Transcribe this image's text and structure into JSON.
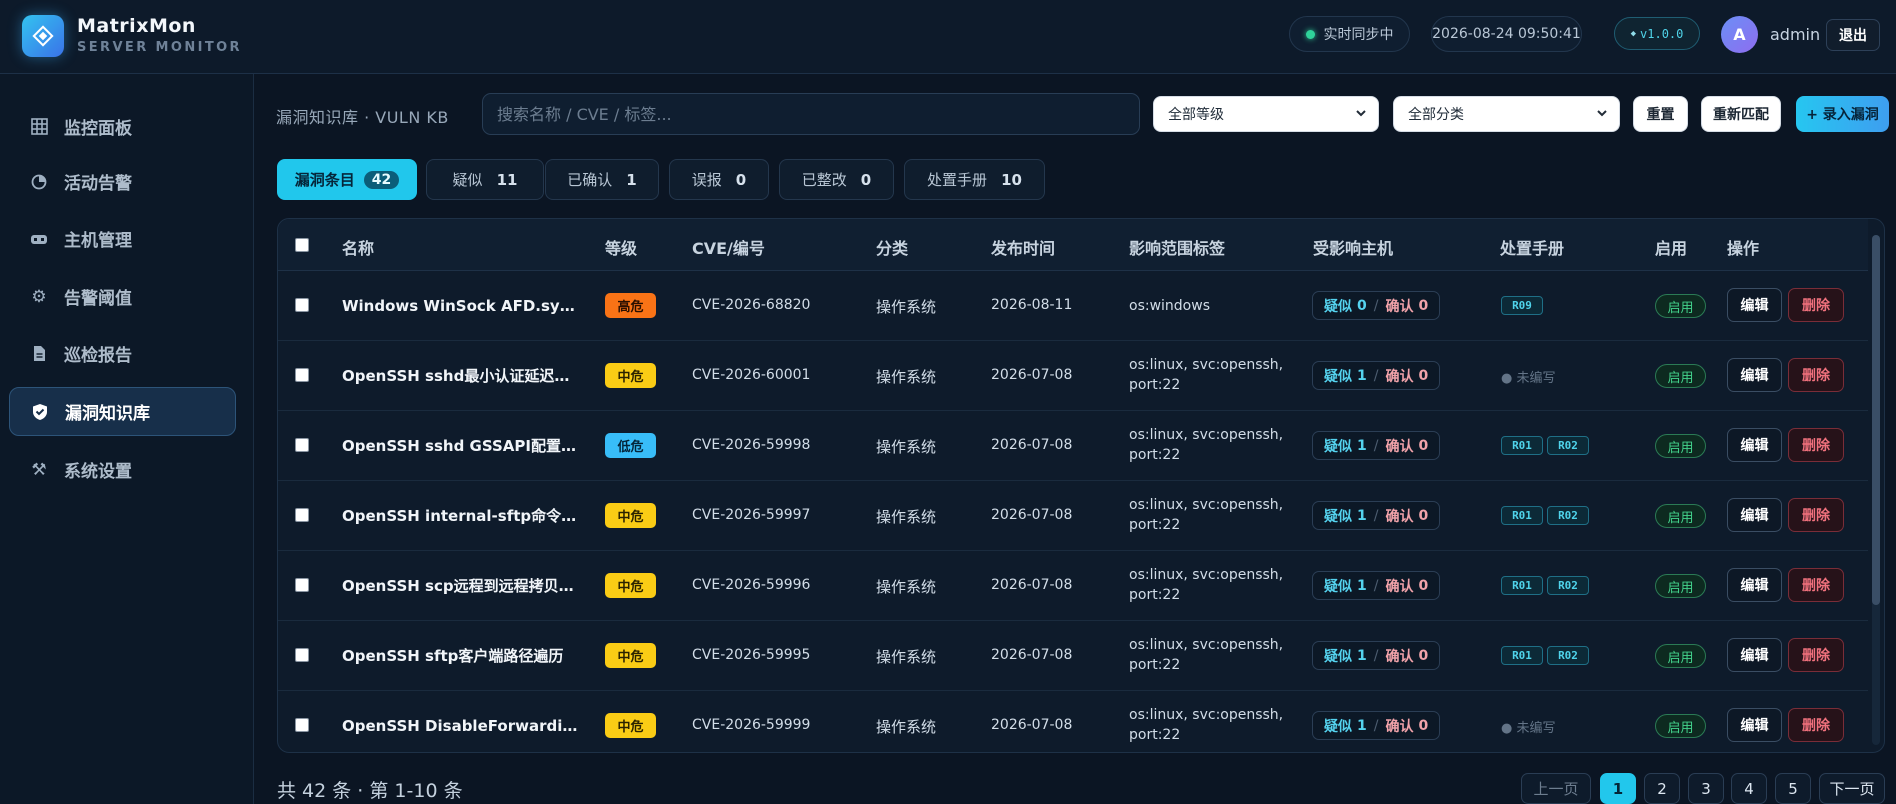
{
  "app": {
    "name": "MatrixMon",
    "subtitle": "SERVER MONITOR",
    "sync_status": "实时同步中",
    "datetime": "2026-08-24 09:50:41",
    "version": "v1.0.0",
    "avatar_initial": "A",
    "username": "admin",
    "logout_label": "退出"
  },
  "sidebar": {
    "items": [
      {
        "label": "监控面板",
        "icon": "grid-icon"
      },
      {
        "label": "活动告警",
        "icon": "pie-icon"
      },
      {
        "label": "主机管理",
        "icon": "server-icon"
      },
      {
        "label": "告警阈值",
        "icon": "gear-icon"
      },
      {
        "label": "巡检报告",
        "icon": "document-icon"
      },
      {
        "label": "漏洞知识库",
        "icon": "shield-icon",
        "active": true
      },
      {
        "label": "系统设置",
        "icon": "tools-icon"
      }
    ]
  },
  "toolbar": {
    "title": "漏洞知识库 · VULN KB",
    "search_placeholder": "搜索名称 / CVE / 标签...",
    "level_select": "全部等级",
    "category_select": "全部分类",
    "reset_label": "重置",
    "rematch_label": "重新匹配",
    "add_label": "+ 录入漏洞"
  },
  "tabs": [
    {
      "label": "漏洞条目",
      "count": "42",
      "active": true
    },
    {
      "label": "疑似",
      "count": "11"
    },
    {
      "label": "已确认",
      "count": "1"
    },
    {
      "label": "误报",
      "count": "0"
    },
    {
      "label": "已整改",
      "count": "0"
    },
    {
      "label": "处置手册",
      "count": "10"
    }
  ],
  "table": {
    "headers": [
      "名称",
      "等级",
      "CVE/编号",
      "分类",
      "发布时间",
      "影响范围标签",
      "受影响主机",
      "处置手册",
      "启用",
      "操作"
    ],
    "suspect_prefix": "疑似",
    "confirm_prefix": "确认",
    "unwritten_label": "● 未编写",
    "enabled_label": "启用",
    "edit_label": "编辑",
    "delete_label": "删除",
    "rows": [
      {
        "name": "Windows WinSock AFD.sys 释放...",
        "level": "高危",
        "level_color": "#f97316",
        "level_text_color": "#2a0f00",
        "cve": "CVE-2026-68820",
        "category": "操作系统",
        "date": "2026-08-11",
        "impact_1": "os:windows",
        "impact_2": "",
        "suspect": "0",
        "confirm": "0",
        "playbooks": [
          "R09"
        ]
      },
      {
        "name": "OpenSSH sshd最小认证延迟绕过",
        "level": "中危",
        "level_color": "#facc15",
        "level_text_color": "#2b2300",
        "cve": "CVE-2026-60001",
        "category": "操作系统",
        "date": "2026-07-08",
        "impact_1": "os:linux, svc:openssh,",
        "impact_2": "port:22",
        "suspect": "1",
        "confirm": "0",
        "playbooks": []
      },
      {
        "name": "OpenSSH sshd GSSAPI配置文档...",
        "level": "低危",
        "level_color": "#38bdf8",
        "level_text_color": "#04253a",
        "cve": "CVE-2026-59998",
        "category": "操作系统",
        "date": "2026-07-08",
        "impact_1": "os:linux, svc:openssh,",
        "impact_2": "port:22",
        "suspect": "1",
        "confirm": "0",
        "playbooks": [
          "R01",
          "R02"
        ]
      },
      {
        "name": "OpenSSH internal-sftp命令行参...",
        "level": "中危",
        "level_color": "#facc15",
        "level_text_color": "#2b2300",
        "cve": "CVE-2026-59997",
        "category": "操作系统",
        "date": "2026-07-08",
        "impact_1": "os:linux, svc:openssh,",
        "impact_2": "port:22",
        "suspect": "1",
        "confirm": "0",
        "playbooks": [
          "R01",
          "R02"
        ]
      },
      {
        "name": "OpenSSH scp远程到远程拷贝父...",
        "level": "中危",
        "level_color": "#facc15",
        "level_text_color": "#2b2300",
        "cve": "CVE-2026-59996",
        "category": "操作系统",
        "date": "2026-07-08",
        "impact_1": "os:linux, svc:openssh,",
        "impact_2": "port:22",
        "suspect": "1",
        "confirm": "0",
        "playbooks": [
          "R01",
          "R02"
        ]
      },
      {
        "name": "OpenSSH sftp客户端路径遍历",
        "level": "中危",
        "level_color": "#facc15",
        "level_text_color": "#2b2300",
        "cve": "CVE-2026-59995",
        "category": "操作系统",
        "date": "2026-07-08",
        "impact_1": "os:linux, svc:openssh,",
        "impact_2": "port:22",
        "suspect": "1",
        "confirm": "0",
        "playbooks": [
          "R01",
          "R02"
        ]
      },
      {
        "name": "OpenSSH DisableForwarding限...",
        "level": "中危",
        "level_color": "#facc15",
        "level_text_color": "#2b2300",
        "cve": "CVE-2026-59999",
        "category": "操作系统",
        "date": "2026-07-08",
        "impact_1": "os:linux, svc:openssh,",
        "impact_2": "port:22",
        "suspect": "1",
        "confirm": "0",
        "playbooks": []
      }
    ]
  },
  "pagination": {
    "total_text": "共 42 条 · 第 1-10 条",
    "prev_label": "上一页",
    "next_label": "下一页",
    "pages": [
      "1",
      "2",
      "3",
      "4",
      "5"
    ],
    "current": "1"
  },
  "colors": {
    "accent": "#22c7ec",
    "background": "#0b1523",
    "danger": "#f0717d",
    "success": "#43d38c"
  }
}
